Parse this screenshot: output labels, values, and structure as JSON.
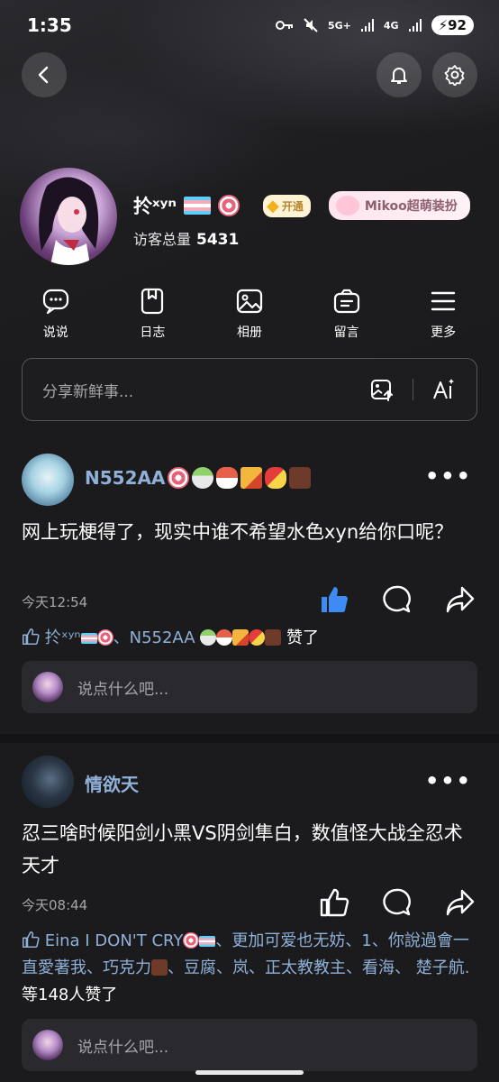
{
  "status_bar": {
    "time": "1:35",
    "network_5g": "5G+",
    "network_4g": "4G",
    "battery": "92"
  },
  "header": {
    "back_icon": "back-arrow-icon",
    "bell_icon": "bell-icon",
    "settings_icon": "gear-icon"
  },
  "profile": {
    "username": "扵ˣʸⁿ",
    "vip_label": "开通",
    "mikoo_label": "Mikoo超萌装扮",
    "visitors_label": "访客总量",
    "visitors_count": "5431"
  },
  "actions": [
    {
      "label": "说说",
      "icon": "chat-bubble-icon"
    },
    {
      "label": "日志",
      "icon": "bookmark-icon"
    },
    {
      "label": "相册",
      "icon": "image-icon"
    },
    {
      "label": "留言",
      "icon": "message-box-icon"
    },
    {
      "label": "更多",
      "icon": "menu-icon"
    }
  ],
  "share": {
    "placeholder": "分享新鲜事..."
  },
  "posts": [
    {
      "author": "N552AA",
      "text": "网上玩梗得了，现实中谁不希望水色xyn给你口呢？",
      "time": "今天12:54",
      "likes_a": "扵ˣʸⁿ",
      "likes_sep": "、",
      "likes_b": "N552AA",
      "likes_suffix": "赞了",
      "comment_placeholder": "说点什么吧..."
    },
    {
      "author": "情欲天",
      "text": "忍三啥时候阳剑小黑VS阴剑隼白，数值怪大战全忍术天才",
      "time": "今天08:44",
      "likes_names": "Eina I DON'T CRY",
      "likes_rest": "、更加可爱也无妨、1、你說過會一直愛著我、巧克力",
      "likes_rest2": "、豆腐、岚、正太教教主、看海、  楚子航.",
      "likes_suffix": "等148人赞了",
      "comment_placeholder": "说点什么吧..."
    }
  ]
}
